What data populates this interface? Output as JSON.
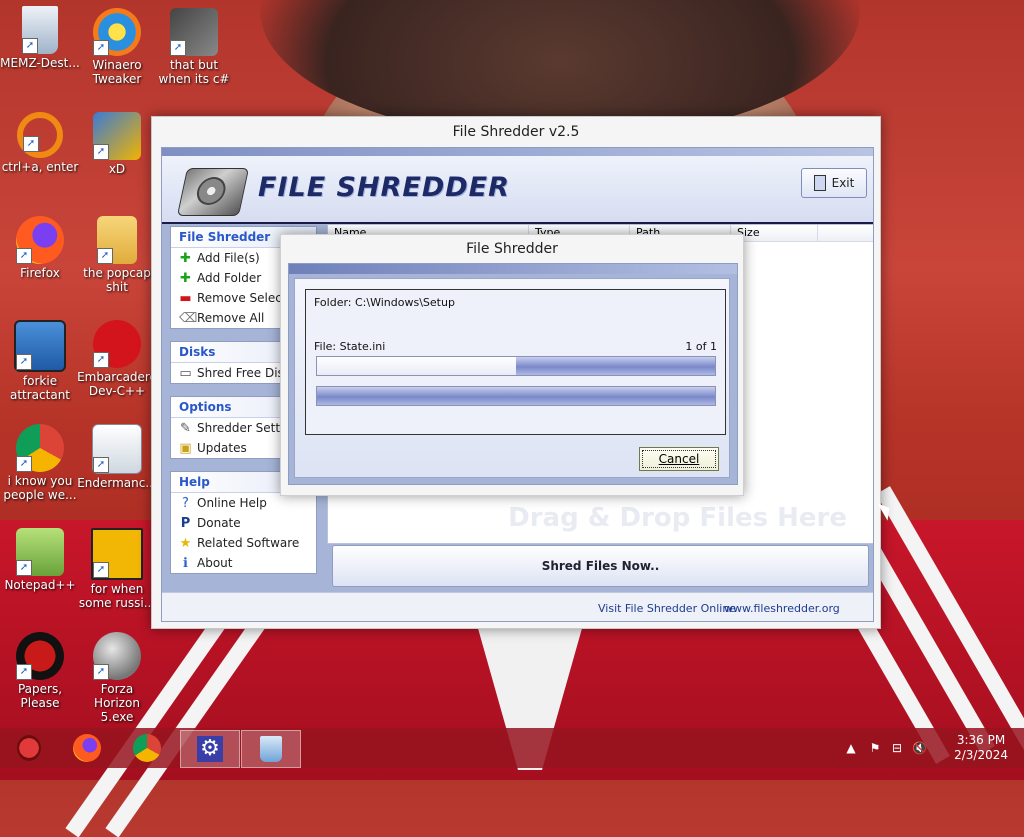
{
  "desktop_icons": [
    {
      "label": "MEMZ-Dest...",
      "icon": "recycle-bin-icon"
    },
    {
      "label": "Winaero Tweaker",
      "icon": "winaero-icon"
    },
    {
      "label": "that but when its c#",
      "icon": "stacked-windows-icon"
    },
    {
      "label": "ctrl+a, enter",
      "icon": "orange-search-icon"
    },
    {
      "label": "xD",
      "icon": "hxd-icon"
    },
    {
      "label": "Firefox",
      "icon": "firefox-icon"
    },
    {
      "label": "the popcap shit",
      "icon": "folder-icon"
    },
    {
      "label": "forkie attractant",
      "icon": "monitor-gear-icon"
    },
    {
      "label": "Embarcadero Dev-C++",
      "icon": "devcpp-icon"
    },
    {
      "label": "i know you people we...",
      "icon": "chrome-icon"
    },
    {
      "label": "Endermanc...",
      "icon": "window-screenshot-icon"
    },
    {
      "label": "Notepad++",
      "icon": "notepadpp-icon"
    },
    {
      "label": "for when some russi...",
      "icon": "de-icon"
    },
    {
      "label": "Papers, Please",
      "icon": "papers-please-icon"
    },
    {
      "label": "Forza Horizon 5.exe",
      "icon": "flash-icon"
    }
  ],
  "main_window": {
    "title": "File Shredder v2.5",
    "logo_text": "FILE SHREDDER",
    "exit_label": "Exit",
    "groups": [
      {
        "title": "File Shredder",
        "items": [
          {
            "label": "Add File(s)",
            "icon": "plus-icon"
          },
          {
            "label": "Add Folder",
            "icon": "plus-icon"
          },
          {
            "label": "Remove Selected",
            "icon": "minus-icon"
          },
          {
            "label": "Remove All",
            "icon": "eraser-icon"
          }
        ]
      },
      {
        "title": "Disks",
        "items": [
          {
            "label": "Shred Free Disk",
            "icon": "disk-icon"
          }
        ]
      },
      {
        "title": "Options",
        "items": [
          {
            "label": "Shredder Settings",
            "icon": "settings-icon"
          },
          {
            "label": "Updates",
            "icon": "updates-icon"
          }
        ]
      },
      {
        "title": "Help",
        "items": [
          {
            "label": "Online Help",
            "icon": "help-icon"
          },
          {
            "label": "Donate",
            "icon": "donate-icon"
          },
          {
            "label": "Related Software",
            "icon": "star-icon"
          },
          {
            "label": "About",
            "icon": "info-icon"
          }
        ]
      }
    ],
    "columns": [
      "Name",
      "Type",
      "Path",
      "Size"
    ],
    "drop_hint": "Drag & Drop Files Here",
    "shred_button": "Shred Files Now..",
    "status_visit": "Visit File Shredder Online",
    "status_url": "www.fileshredder.org"
  },
  "progress_dialog": {
    "title": "File Shredder",
    "folder_text": "Folder: C:\\Windows\\Setup",
    "file_text": "File: State.ini",
    "count_text": "1  of  1",
    "file_progress": 0.5,
    "total_progress": 1.0,
    "cancel_label": "Cancel"
  },
  "taskbar": {
    "apps": [
      "bug-icon",
      "firefox-icon",
      "chrome-icon",
      "settings-gear-icon",
      "recycle-bin-icon"
    ],
    "time": "3:36 PM",
    "date": "2/3/2024"
  }
}
